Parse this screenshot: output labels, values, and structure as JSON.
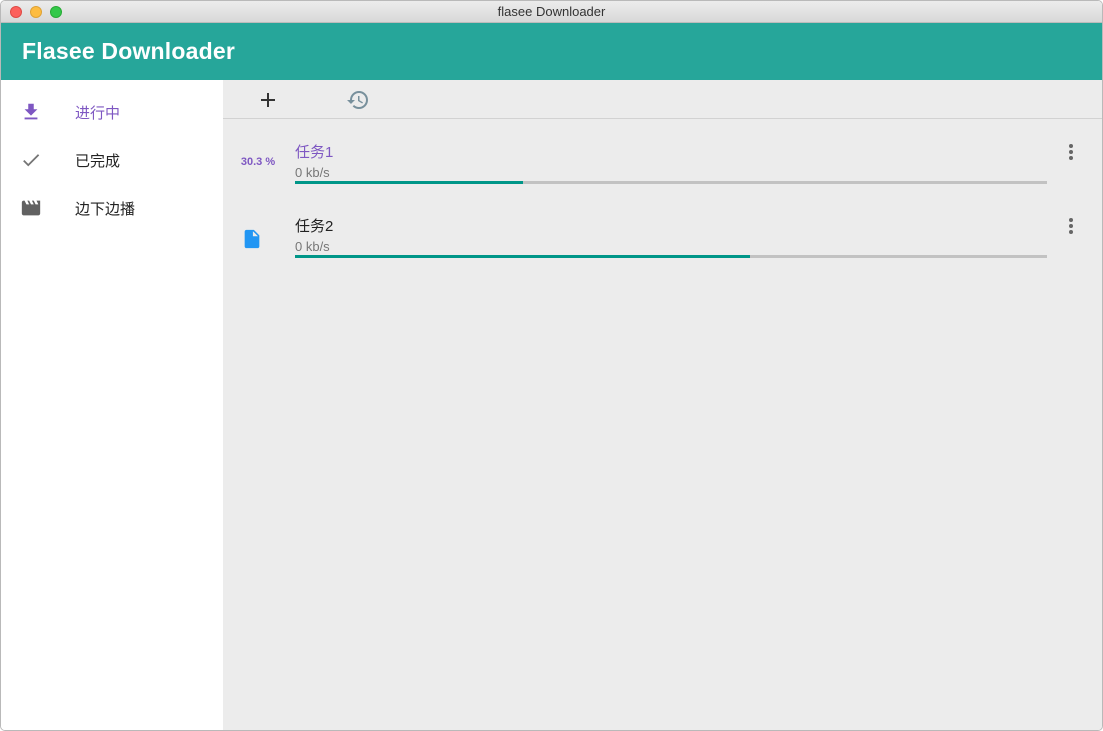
{
  "window": {
    "title": "flasee Downloader"
  },
  "appbar": {
    "title": "Flasee Downloader",
    "color": "#26a69a"
  },
  "sidebar": {
    "items": [
      {
        "label": "进行中",
        "icon": "download-icon",
        "active": true
      },
      {
        "label": "已完成",
        "icon": "check-icon",
        "active": false
      },
      {
        "label": "边下边播",
        "icon": "movie-clapper-icon",
        "active": false
      }
    ],
    "accent": "#7e57c2"
  },
  "toolbar": {
    "buttons": [
      {
        "icon": "add-icon"
      },
      {
        "icon": "history-icon"
      }
    ]
  },
  "tasks": [
    {
      "name": "任务1",
      "speed": "0 kb/s",
      "percent_label": "30.3 %",
      "progress": 0.303
    },
    {
      "name": "任务2",
      "speed": "0 kb/s",
      "icon": "file-icon",
      "progress": 0.605
    }
  ],
  "colors": {
    "progress": "#009688",
    "progress_track": "#c2c2c2",
    "file_icon": "#2196f3"
  }
}
